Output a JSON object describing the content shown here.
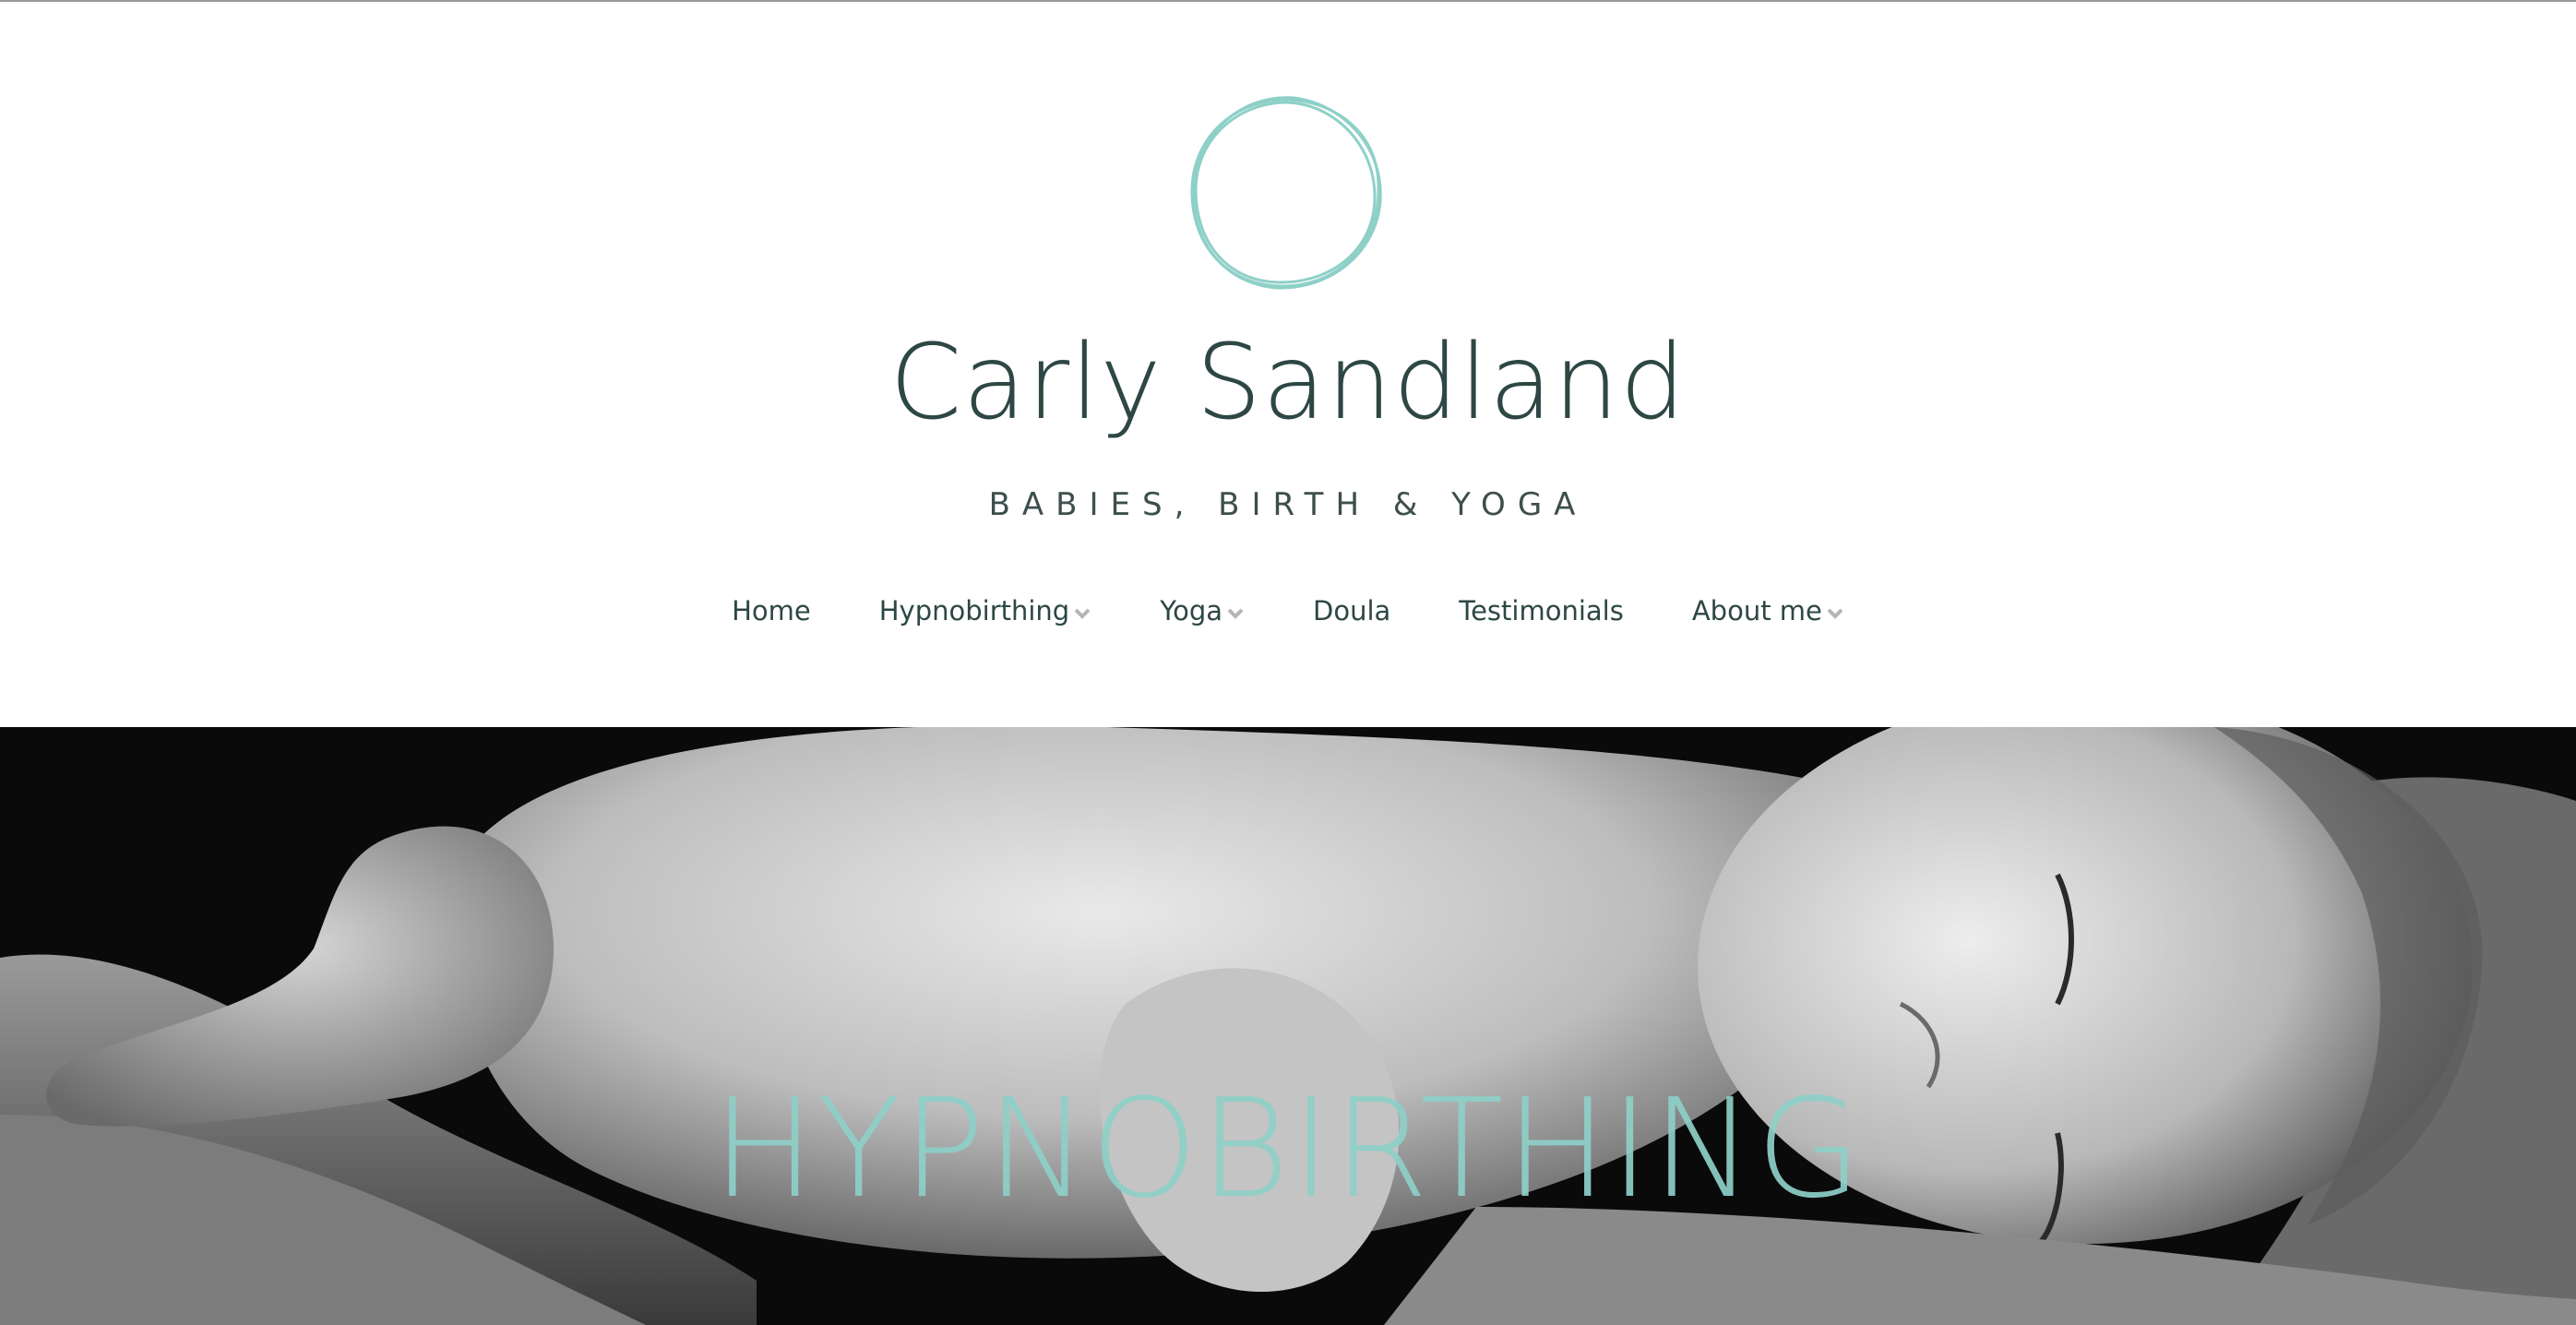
{
  "site": {
    "title": "Carly Sandland",
    "tagline": "BABIES, BIRTH & YOGA",
    "logo_icon": "hand-drawn-circle-icon"
  },
  "nav": {
    "items": [
      {
        "label": "Home",
        "has_dropdown": false
      },
      {
        "label": "Hypnobirthing",
        "has_dropdown": true
      },
      {
        "label": "Yoga",
        "has_dropdown": true
      },
      {
        "label": "Doula",
        "has_dropdown": false
      },
      {
        "label": "Testimonials",
        "has_dropdown": false
      },
      {
        "label": "About me",
        "has_dropdown": true
      }
    ]
  },
  "hero": {
    "heading": "HYPNOBIRTHING",
    "image_subject": "sleeping newborn baby held in hands (black and white photo)"
  },
  "colors": {
    "brand_dark": "#2d4744",
    "accent_teal": "#8ed0c8",
    "chevron_grey": "#b5b5b5",
    "background": "#ffffff"
  }
}
